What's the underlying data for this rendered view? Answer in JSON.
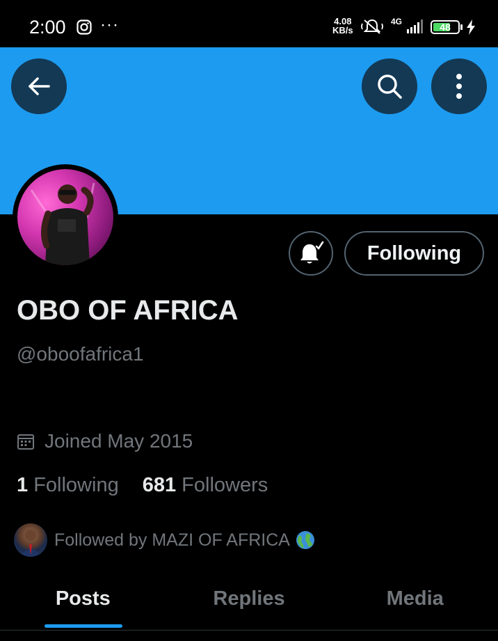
{
  "status_bar": {
    "time": "2:00",
    "dots": "···",
    "speed_top": "4.08",
    "speed_bottom": "KB/s",
    "network": "4G",
    "battery": "48"
  },
  "profile": {
    "display_name": "OBO OF AFRICA",
    "handle": "@oboofafrica1",
    "joined": "Joined May 2015",
    "following_count": "1",
    "following_label": "Following",
    "followers_count": "681",
    "followers_label": "Followers",
    "followed_by": "Followed by MAZI OF AFRICA"
  },
  "actions": {
    "following_button": "Following"
  },
  "tabs": [
    {
      "label": "Posts",
      "active": true
    },
    {
      "label": "Replies",
      "active": false
    },
    {
      "label": "Media",
      "active": false
    }
  ],
  "colors": {
    "banner": "#1d9bf0",
    "accent": "#1d9bf0",
    "background": "#000000",
    "secondary_text": "#71767b"
  },
  "icons": [
    "back-arrow-icon",
    "search-icon",
    "more-vertical-icon",
    "bell-icon",
    "calendar-icon",
    "globe-icon"
  ]
}
